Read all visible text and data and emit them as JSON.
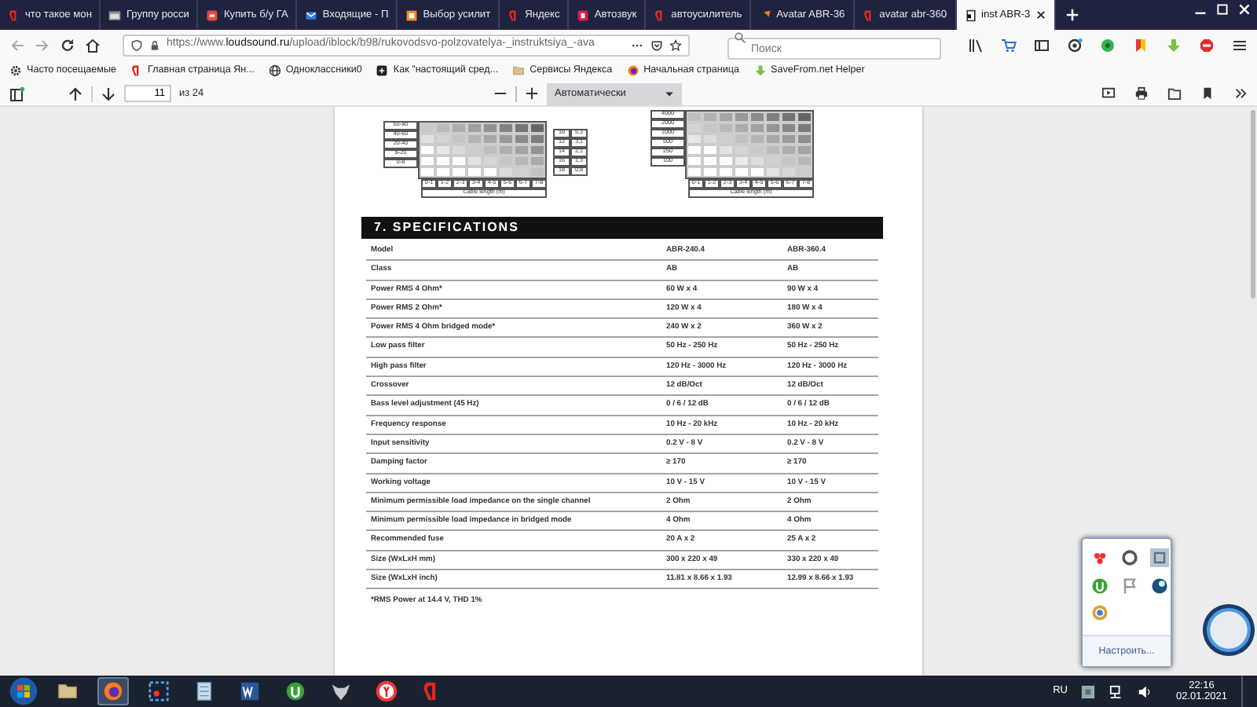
{
  "browser_tabs": [
    {
      "title": "что такое мон",
      "selected": false
    },
    {
      "title": "Группу росси",
      "selected": false
    },
    {
      "title": "Купить б/у ГА",
      "selected": false
    },
    {
      "title": "Входящие - П",
      "selected": false
    },
    {
      "title": "Выбор усилит",
      "selected": false
    },
    {
      "title": "Яндекс",
      "selected": false
    },
    {
      "title": "Автозвук",
      "selected": false
    },
    {
      "title": "автоусилитель",
      "selected": false
    },
    {
      "title": "Avatar ABR-36",
      "selected": false
    },
    {
      "title": "avatar abr-360",
      "selected": false
    },
    {
      "title": "inst ABR-3",
      "selected": true
    }
  ],
  "nav": {
    "url": "https://www.**loudsound.ru**/upload/iblock/b98/rukovodsvo-polzovatelya-_instruktsiya_-ava",
    "search_placeholder": "Поиск"
  },
  "bookmarks": [
    {
      "label": "Часто посещаемые"
    },
    {
      "label": "Главная страница Ян..."
    },
    {
      "label": "Одноклассники0"
    },
    {
      "label": "Как \"настоящий сред..."
    },
    {
      "label": "Сервисы Яндекса"
    },
    {
      "label": "Начальная страница"
    },
    {
      "label": "SaveFrom.net Helper"
    }
  ],
  "pdf_toolbar": {
    "page": "11",
    "page_count": "из 24",
    "zoom": "Автоматически"
  },
  "document": {
    "charts": [
      {
        "kind": "heatmap",
        "row_labels": [
          "60-80",
          "40-60",
          "20-40",
          "8-20",
          "0-8"
        ],
        "column_labels": [
          "0-1",
          "1-2",
          "2-3",
          "3-4",
          "4-5",
          "5-6",
          "6-7",
          "7-8"
        ],
        "xlabel": "Cable length (m)"
      },
      {
        "kind": "table",
        "rows": [
          [
            "10",
            "5,3"
          ],
          [
            "12",
            "3,1"
          ],
          [
            "14",
            "2,1"
          ],
          [
            "16",
            "1,3"
          ],
          [
            "18",
            "0,8"
          ]
        ]
      },
      {
        "kind": "heatmap",
        "row_labels": [
          "4000",
          "2000",
          "1000",
          "500",
          "250",
          "100"
        ],
        "column_labels": [
          "0-1",
          "1-2",
          "2-3",
          "3-4",
          "4-5",
          "5-6",
          "6-7",
          "7-8"
        ],
        "xlabel": "Cable length (m)"
      }
    ],
    "section_title": "7. SPECIFICATIONS",
    "spec_rows": [
      [
        "Model",
        "ABR-240.4",
        "ABR-360.4"
      ],
      [
        "Class",
        "AB",
        "AB"
      ],
      [
        "Power RMS 4 Ohm*",
        "60 W x 4",
        "90 W x 4"
      ],
      [
        "Power RMS 2 Ohm*",
        "120 W x 4",
        "180 W x 4"
      ],
      [
        "Power RMS 4 Ohm bridged mode*",
        "240 W x 2",
        "360 W x 2"
      ],
      [
        "Low pass filter",
        "50 Hz - 250 Hz",
        "50 Hz - 250 Hz"
      ],
      [
        "High pass filter",
        "120 Hz - 3000 Hz",
        "120 Hz - 3000 Hz"
      ],
      [
        "Crossover",
        "12 dB/Oct",
        "12 dB/Oct"
      ],
      [
        "Bass level adjustment (45 Hz)",
        "0 / 6 / 12 dB",
        "0 / 6 / 12 dB"
      ],
      [
        "Frequency response",
        "10 Hz - 20 kHz",
        "10 Hz - 20 kHz"
      ],
      [
        "Input sensitivity",
        "0.2 V - 8 V",
        "0.2 V - 8 V"
      ],
      [
        "Damping factor",
        "≥ 170",
        "≥ 170"
      ],
      [
        "Working voltage",
        "10 V - 15 V",
        "10 V - 15 V"
      ],
      [
        "Minimum permissible load impedance on the single channel",
        "2 Ohm",
        "2 Ohm"
      ],
      [
        "Minimum permissible load impedance in bridged mode",
        "4 Ohm",
        "4 Ohm"
      ],
      [
        "Recommended fuse",
        "20 A x 2",
        "25 A x 2"
      ],
      [
        "Size (WxLxH mm)",
        "300 x 220 x 49",
        "330 x 220 x 49"
      ],
      [
        "Size (WxLxH inch)",
        "11.81 x 8.66 x 1.93",
        "12.99 x 8.66 x 1.93"
      ]
    ],
    "footnote": "*RMS Power at 14.4 V, THD 1%"
  },
  "tray_popup": {
    "customize": "Настроить..."
  },
  "taskbar": {
    "apps": [
      {
        "active": false
      },
      {
        "active": true
      },
      {
        "active": false
      },
      {
        "active": false
      },
      {
        "active": false
      },
      {
        "active": false
      },
      {
        "active": false
      },
      {
        "active": false
      },
      {
        "active": false
      }
    ],
    "language": "RU",
    "time": "22:16",
    "date": "02.01.2021"
  }
}
